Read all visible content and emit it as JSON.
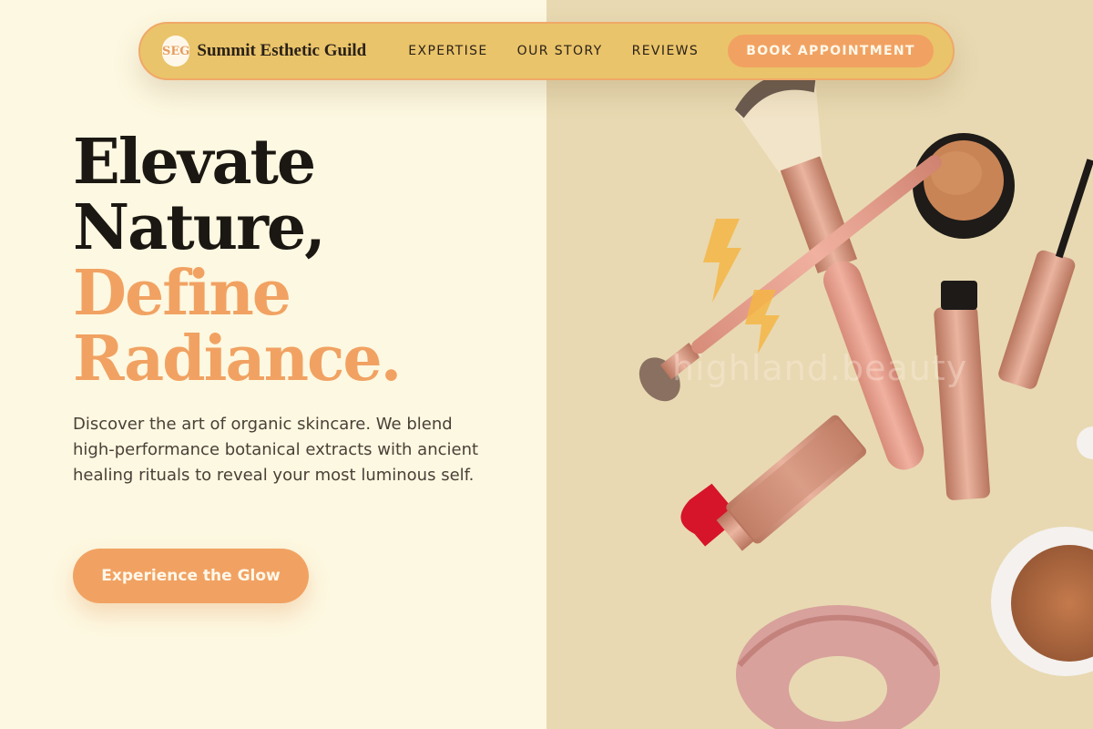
{
  "nav": {
    "logo_badge": "SEG",
    "brand": "Summit Esthetic Guild",
    "links": [
      "EXPERTISE",
      "OUR STORY",
      "REVIEWS"
    ],
    "cta": "BOOK APPOINTMENT"
  },
  "hero": {
    "title_line1": "Elevate",
    "title_line2": "Nature,",
    "title_line3": "Define",
    "title_line4": "Radiance.",
    "description": "Discover the art of organic skincare. We blend high-performance botanical extracts with ancient healing rituals to reveal your most luminous self.",
    "cta": "Experience the Glow"
  },
  "image": {
    "watermark": "highland.beauty",
    "icons": [
      "makeup-brush-icon",
      "lipstick-icon",
      "mascara-icon",
      "compact-icon",
      "scrunchie-icon"
    ]
  },
  "colors": {
    "background": "#fdf8e1",
    "image_background": "#e8d9b2",
    "nav_background": "#eac46a",
    "accent": "#f1a262",
    "text_dark": "#1b1712"
  }
}
